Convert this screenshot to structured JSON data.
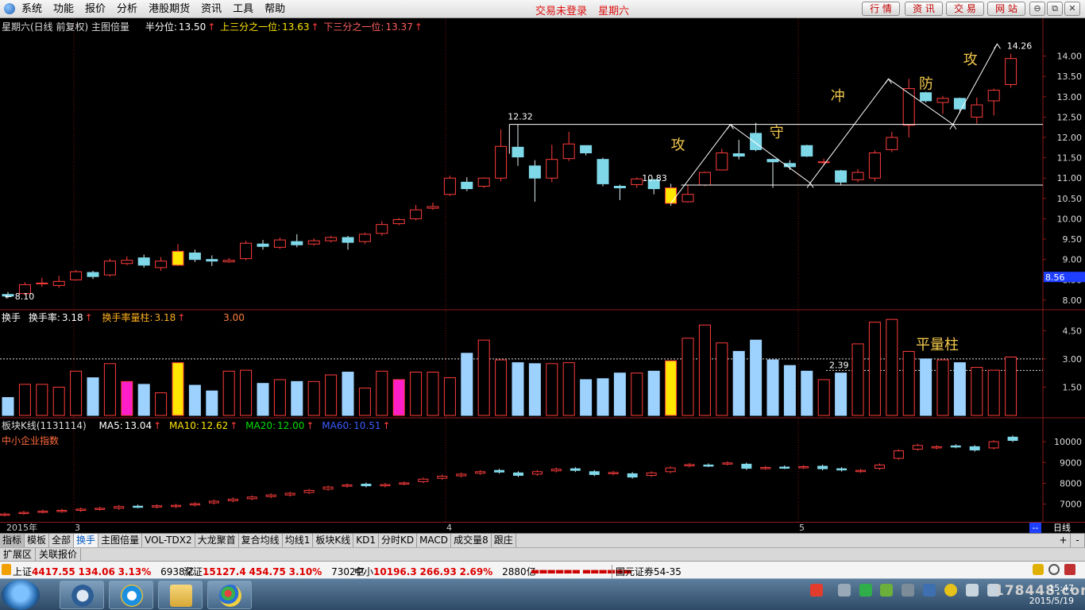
{
  "menubar": {
    "items": [
      "系统",
      "功能",
      "报价",
      "分析",
      "港股期货",
      "资讯",
      "工具",
      "帮助"
    ],
    "status": [
      "交易未登录",
      "星期六"
    ],
    "buttons": [
      "行 情",
      "资 讯",
      "交 易",
      "网 站"
    ],
    "window_buttons": [
      "⊖",
      "⧉",
      "✕"
    ]
  },
  "main_panel": {
    "title": "星期六(日线 前复权) 主图倍量",
    "legend": [
      {
        "label": "半分位:",
        "value": "13.50",
        "color": "#ffffff"
      },
      {
        "label": "上三分之一位:",
        "value": "13.63",
        "color": "#ffe600"
      },
      {
        "label": "下三分之一位:",
        "value": "13.37",
        "color": "#ff6060"
      }
    ],
    "price_axis": [
      "14.00",
      "13.50",
      "13.00",
      "12.50",
      "12.00",
      "11.50",
      "11.00",
      "10.50",
      "10.00",
      "9.50",
      "9.00",
      "8.50",
      "8.00"
    ],
    "current_price": "8.56",
    "annotations": {
      "low_start": "8.10",
      "peak_left": "12.32",
      "support": "10.83",
      "high_last": "14.26",
      "words": [
        "攻",
        "守",
        "冲",
        "防",
        "攻"
      ]
    }
  },
  "turnover_panel": {
    "title": "换手",
    "legend": [
      {
        "label": "换手率:",
        "value": "3.18"
      },
      {
        "label": "换手率量柱:",
        "value": "3.18"
      },
      {
        "label": "",
        "value": "3.00"
      }
    ],
    "axis": [
      "4.50",
      "3.00",
      "1.50"
    ],
    "ref_line_label": "2.39",
    "annotation": "平量柱"
  },
  "index_panel": {
    "title": "板块K线(1131114)",
    "legend": [
      {
        "label": "MA5:",
        "value": "13.04",
        "color": "#ffffff"
      },
      {
        "label": "MA10:",
        "value": "12.62",
        "color": "#ffe600"
      },
      {
        "label": "MA20:",
        "value": "12.00",
        "color": "#00e000"
      },
      {
        "label": "MA60:",
        "value": "10.51",
        "color": "#3a5cff"
      }
    ],
    "subtitle": "中小企业指数",
    "axis": [
      "10000",
      "9000",
      "8000",
      "7000"
    ]
  },
  "date_axis": {
    "labels": [
      "2015年",
      "3",
      "4",
      "5"
    ],
    "period": "日线"
  },
  "tabs": [
    "指标",
    "模板",
    "全部",
    "换手",
    "主图倍量",
    "VOL-TDX2",
    "大龙聚首",
    "复合均线",
    "均线1",
    "板块K线",
    "KD1",
    "分时KD",
    "MACD",
    "成交量8",
    "跟庄"
  ],
  "active_tab": "换手",
  "subtabs": [
    "扩展区",
    "关联报价"
  ],
  "nav_buttons": [
    "+",
    "-"
  ],
  "ticker": {
    "items": [
      {
        "name": "上证",
        "value": "4417.55",
        "change": "134.06",
        "pct": "3.13%",
        "amount": "6938亿"
      },
      {
        "name": "深证",
        "value": "15127.4",
        "change": "454.75",
        "pct": "3.10%",
        "amount": "7302亿"
      },
      {
        "name": "中小",
        "value": "10196.3",
        "change": "266.93",
        "pct": "2.69%",
        "amount": "2880亿"
      }
    ],
    "broker": "国元证券54-35"
  },
  "taskbar": {
    "time": "15:47",
    "date": "2015/5/19",
    "watermark": "178448.com"
  },
  "chart_data": {
    "type": "candlestick",
    "price_range": [
      7.9,
      14.5
    ],
    "candles": [
      [
        8.14,
        8.1,
        8.2,
        8.05
      ],
      [
        8.16,
        8.38,
        8.44,
        8.12
      ],
      [
        8.4,
        8.42,
        8.55,
        8.33
      ],
      [
        8.36,
        8.46,
        8.6,
        8.3
      ],
      [
        8.5,
        8.7,
        8.74,
        8.48
      ],
      [
        8.68,
        8.58,
        8.72,
        8.52
      ],
      [
        8.62,
        8.96,
        9.02,
        8.58
      ],
      [
        8.9,
        8.98,
        9.08,
        8.86
      ],
      [
        9.04,
        8.86,
        9.12,
        8.8
      ],
      [
        8.8,
        8.96,
        9.06,
        8.72
      ],
      [
        8.86,
        9.2,
        9.38,
        8.84
      ],
      [
        9.16,
        9.0,
        9.24,
        8.94
      ],
      [
        9.0,
        8.96,
        9.1,
        8.84
      ],
      [
        8.94,
        8.98,
        9.04,
        8.92
      ],
      [
        9.02,
        9.4,
        9.46,
        8.98
      ],
      [
        9.38,
        9.32,
        9.48,
        9.24
      ],
      [
        9.3,
        9.48,
        9.54,
        9.26
      ],
      [
        9.44,
        9.36,
        9.62,
        9.3
      ],
      [
        9.38,
        9.46,
        9.52,
        9.34
      ],
      [
        9.46,
        9.54,
        9.58,
        9.42
      ],
      [
        9.54,
        9.42,
        9.58,
        9.24
      ],
      [
        9.44,
        9.62,
        9.66,
        9.38
      ],
      [
        9.64,
        9.86,
        9.94,
        9.58
      ],
      [
        9.88,
        9.98,
        10.02,
        9.84
      ],
      [
        10.0,
        10.22,
        10.34,
        9.96
      ],
      [
        10.26,
        10.3,
        10.4,
        10.22
      ],
      [
        10.6,
        11.0,
        11.06,
        10.56
      ],
      [
        10.9,
        10.74,
        11.02,
        10.68
      ],
      [
        10.8,
        11.0,
        11.02,
        10.76
      ],
      [
        11.0,
        11.78,
        12.2,
        10.92
      ],
      [
        11.76,
        11.52,
        12.32,
        11.3
      ],
      [
        11.3,
        11.0,
        11.44,
        10.42
      ],
      [
        11.0,
        11.46,
        11.82,
        10.9
      ],
      [
        11.48,
        11.84,
        12.14,
        11.42
      ],
      [
        11.8,
        11.62,
        11.8,
        11.56
      ],
      [
        11.46,
        10.86,
        11.5,
        10.8
      ],
      [
        10.8,
        10.76,
        10.84,
        10.46
      ],
      [
        10.84,
        10.98,
        11.02,
        10.76
      ],
      [
        10.96,
        10.74,
        10.98,
        10.6
      ],
      [
        10.76,
        10.38,
        10.86,
        10.32
      ],
      [
        10.42,
        10.6,
        10.82,
        10.4
      ],
      [
        10.83,
        11.14,
        11.16,
        10.8
      ],
      [
        11.2,
        11.62,
        11.72,
        11.2
      ],
      [
        11.6,
        11.54,
        11.94,
        11.46
      ],
      [
        12.1,
        11.7,
        12.36,
        11.66
      ],
      [
        11.46,
        11.4,
        11.48,
        10.76
      ],
      [
        11.36,
        11.28,
        11.44,
        11.2
      ],
      [
        11.8,
        11.54,
        11.82,
        11.52
      ],
      [
        11.4,
        11.4,
        11.48,
        11.34
      ],
      [
        11.18,
        10.9,
        11.2,
        10.84
      ],
      [
        10.96,
        11.14,
        11.22,
        10.9
      ],
      [
        11.0,
        11.62,
        11.68,
        10.92
      ],
      [
        11.7,
        12.0,
        12.14,
        11.64
      ],
      [
        12.3,
        13.2,
        13.44,
        12.0
      ],
      [
        13.1,
        12.9,
        13.12,
        12.86
      ],
      [
        12.86,
        12.96,
        13.02,
        12.58
      ],
      [
        12.96,
        12.7,
        12.98,
        12.6
      ],
      [
        12.5,
        12.8,
        12.98,
        12.34
      ],
      [
        12.9,
        13.16,
        13.2,
        12.54
      ],
      [
        13.3,
        13.94,
        14.06,
        13.22
      ]
    ],
    "turnover_values": [
      0.95,
      1.65,
      1.65,
      1.5,
      2.35,
      2.0,
      2.75,
      1.8,
      1.65,
      1.2,
      2.8,
      1.6,
      1.3,
      2.35,
      2.4,
      1.7,
      1.9,
      1.8,
      1.8,
      2.15,
      2.3,
      1.45,
      2.35,
      1.9,
      2.3,
      2.3,
      2.0,
      3.3,
      4.0,
      2.95,
      2.8,
      2.75,
      2.75,
      2.8,
      1.9,
      1.95,
      2.25,
      2.25,
      2.35,
      2.9,
      4.1,
      4.8,
      3.85,
      3.4,
      4.0,
      2.95,
      2.65,
      2.35,
      1.9,
      2.25,
      3.8,
      4.95,
      5.1,
      3.4,
      3.0,
      2.95,
      2.8,
      2.55,
      2.4,
      3.1
    ],
    "turnover_highlight_yellow": [
      10,
      39
    ],
    "turnover_highlight_magenta": [
      7,
      23
    ],
    "turnover_range": [
      0,
      5.4
    ],
    "turnover_line": 3.0,
    "turnover_ref_line": 2.39,
    "index_candles": [
      [
        6480,
        6520
      ],
      [
        6560,
        6600
      ],
      [
        6620,
        6660
      ],
      [
        6660,
        6700
      ],
      [
        6700,
        6760
      ],
      [
        6760,
        6800
      ],
      [
        6800,
        6880
      ],
      [
        6900,
        6880
      ],
      [
        6860,
        6920
      ],
      [
        6880,
        6940
      ],
      [
        6960,
        7020
      ],
      [
        7060,
        7140
      ],
      [
        7160,
        7240
      ],
      [
        7260,
        7340
      ],
      [
        7360,
        7440
      ],
      [
        7440,
        7520
      ],
      [
        7560,
        7660
      ],
      [
        7720,
        7820
      ],
      [
        7860,
        7920
      ],
      [
        7960,
        7880
      ],
      [
        7880,
        7940
      ],
      [
        7980,
        8020
      ],
      [
        8080,
        8200
      ],
      [
        8240,
        8340
      ],
      [
        8360,
        8440
      ],
      [
        8480,
        8560
      ],
      [
        8620,
        8540
      ],
      [
        8500,
        8380
      ],
      [
        8440,
        8560
      ],
      [
        8600,
        8680
      ],
      [
        8700,
        8620
      ],
      [
        8560,
        8420
      ],
      [
        8460,
        8520
      ],
      [
        8460,
        8300
      ],
      [
        8380,
        8500
      ],
      [
        8560,
        8740
      ],
      [
        8840,
        8900
      ],
      [
        8880,
        8860
      ],
      [
        8940,
        8980
      ],
      [
        8920,
        8720
      ],
      [
        8720,
        8760
      ],
      [
        8780,
        8760
      ],
      [
        8760,
        8800
      ],
      [
        8820,
        8700
      ],
      [
        8700,
        8640
      ],
      [
        8580,
        8620
      ],
      [
        8720,
        8880
      ],
      [
        9200,
        9560
      ],
      [
        9640,
        9820
      ],
      [
        9700,
        9760
      ],
      [
        9800,
        9760
      ],
      [
        9760,
        9600
      ],
      [
        9700,
        10000
      ],
      [
        10220,
        10060
      ]
    ],
    "index_range": [
      6300,
      10500
    ]
  }
}
